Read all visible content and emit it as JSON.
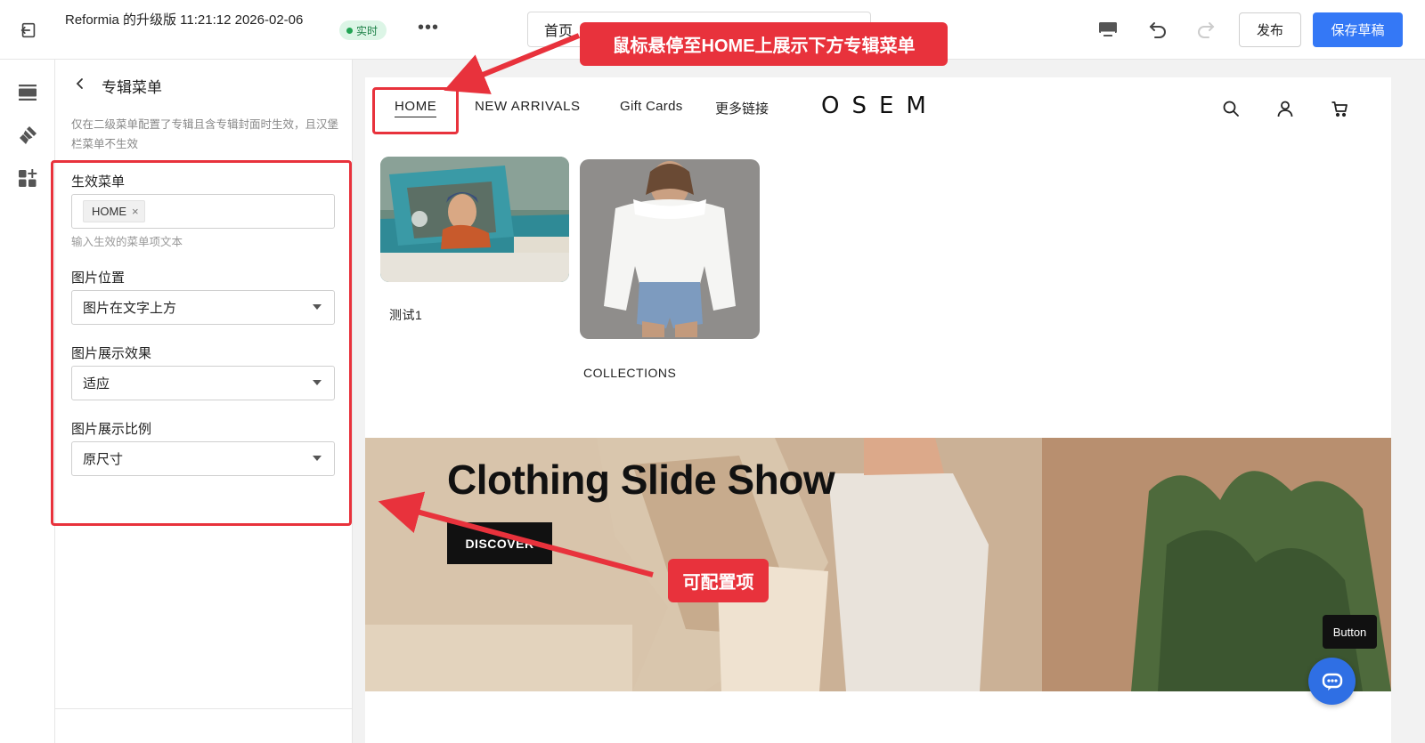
{
  "topbar": {
    "title": "Reformia 的升级版 11:21:12 2026-02-06",
    "live_label": "实时",
    "more_label": "•••",
    "page_select_value": "首页",
    "publish_label": "发布",
    "save_label": "保存草稿"
  },
  "rail": {
    "items": [
      {
        "icon": "layout-sections-icon"
      },
      {
        "icon": "paint-brush-icon"
      },
      {
        "icon": "add-apps-icon"
      }
    ]
  },
  "panel": {
    "title": "专辑菜单",
    "description": "仅在二级菜单配置了专辑且含专辑封面时生效，且汉堡栏菜单不生效",
    "active_menu": {
      "label": "生效菜单",
      "tag": "HOME",
      "hint": "输入生效的菜单项文本"
    },
    "image_position": {
      "label": "图片位置",
      "value": "图片在文字上方"
    },
    "image_effect": {
      "label": "图片展示效果",
      "value": "适应"
    },
    "image_ratio": {
      "label": "图片展示比例",
      "value": "原尺寸"
    }
  },
  "store": {
    "nav": [
      "HOME",
      "NEW ARRIVALS",
      "Gift Cards",
      "更多链接"
    ],
    "logo": "OSEM",
    "menu_items": [
      {
        "caption": "测试1"
      },
      {
        "caption": "COLLECTIONS"
      }
    ],
    "slide": {
      "title": "Clothing Slide Show",
      "button": "DISCOVER"
    },
    "float_button": "Button"
  },
  "annotations": {
    "top_callout": "鼠标悬停至HOME上展示下方专辑菜单",
    "side_callout": "可配置项",
    "color": "#e8323c"
  },
  "colors": {
    "primary": "#3478f6",
    "live_green": "#22a454"
  }
}
